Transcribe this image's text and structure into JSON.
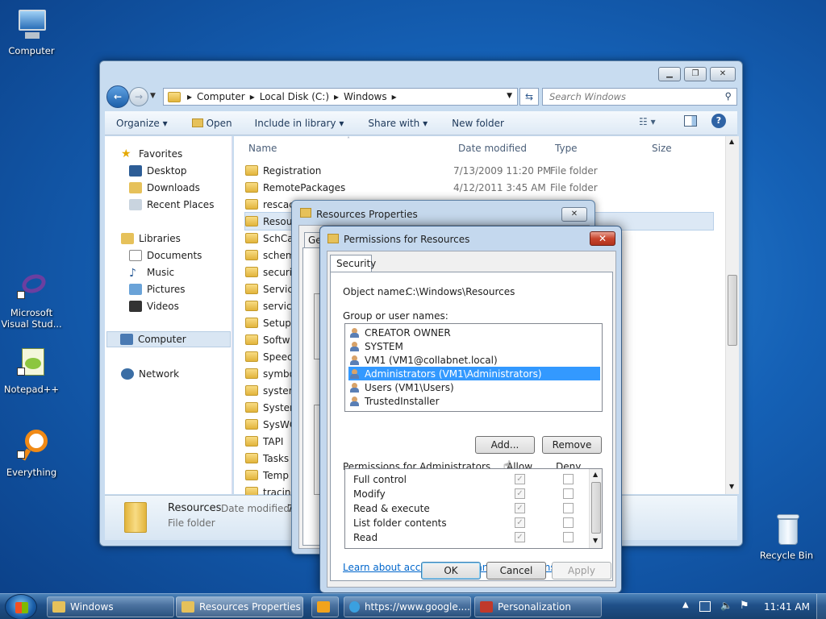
{
  "desktop": {
    "icons": [
      {
        "label": "Computer",
        "icon": "computer-icon"
      },
      {
        "label": "Microsoft Visual Stud...",
        "icon": "visual-studio-icon"
      },
      {
        "label": "Notepad++",
        "icon": "notepad-plus-icon"
      },
      {
        "label": "Everything",
        "icon": "everything-search-icon"
      },
      {
        "label": "Recycle Bin",
        "icon": "recycle-bin-icon"
      }
    ]
  },
  "explorer": {
    "breadcrumb": [
      "Computer",
      "Local Disk (C:)",
      "Windows"
    ],
    "search_placeholder": "Search Windows",
    "toolbar": {
      "organize": "Organize",
      "open": "Open",
      "include": "Include in library",
      "share": "Share with",
      "new_folder": "New folder"
    },
    "nav": {
      "favorites": "Favorites",
      "desktop": "Desktop",
      "downloads": "Downloads",
      "recent": "Recent Places",
      "libraries": "Libraries",
      "documents": "Documents",
      "music": "Music",
      "pictures": "Pictures",
      "videos": "Videos",
      "computer": "Computer",
      "network": "Network"
    },
    "columns": {
      "name": "Name",
      "date": "Date modified",
      "type": "Type",
      "size": "Size"
    },
    "files": [
      {
        "name": "Registration",
        "date": "7/13/2009 11:20 PM",
        "type": "File folder"
      },
      {
        "name": "RemotePackages",
        "date": "4/12/2011 3:45 AM",
        "type": "File folder"
      },
      {
        "name": "rescache",
        "date": "",
        "type": ""
      },
      {
        "name": "Resou",
        "date": "",
        "type": ""
      },
      {
        "name": "SchCa",
        "date": "",
        "type": ""
      },
      {
        "name": "schem",
        "date": "",
        "type": ""
      },
      {
        "name": "securi",
        "date": "",
        "type": ""
      },
      {
        "name": "Servic",
        "date": "",
        "type": ""
      },
      {
        "name": "servici",
        "date": "",
        "type": ""
      },
      {
        "name": "Setup",
        "date": "",
        "type": ""
      },
      {
        "name": "Softw",
        "date": "",
        "type": ""
      },
      {
        "name": "Speecl",
        "date": "",
        "type": ""
      },
      {
        "name": "symbo",
        "date": "",
        "type": ""
      },
      {
        "name": "system",
        "date": "",
        "type": ""
      },
      {
        "name": "Systen",
        "date": "",
        "type": ""
      },
      {
        "name": "SysWC",
        "date": "",
        "type": ""
      },
      {
        "name": "TAPI",
        "date": "",
        "type": ""
      },
      {
        "name": "Tasks",
        "date": "",
        "type": ""
      },
      {
        "name": "Temp",
        "date": "",
        "type": ""
      },
      {
        "name": "tracing",
        "date": "",
        "type": ""
      }
    ],
    "details": {
      "name": "Resources",
      "date_label": "Date modified:",
      "date_partial": "7",
      "type": "File folder"
    }
  },
  "properties_dialog": {
    "title": "Resources Properties",
    "tab_partial": "Ge"
  },
  "permissions_dialog": {
    "title": "Permissions for Resources",
    "tab": "Security",
    "object_label": "Object name:",
    "object_value": "C:\\Windows\\Resources",
    "groups_label": "Group or user names:",
    "users": [
      {
        "name": "CREATOR OWNER",
        "selected": false
      },
      {
        "name": "SYSTEM",
        "selected": false
      },
      {
        "name": "VM1 (VM1@collabnet.local)",
        "selected": false
      },
      {
        "name": "Administrators (VM1\\Administrators)",
        "selected": true
      },
      {
        "name": "Users (VM1\\Users)",
        "selected": false
      },
      {
        "name": "TrustedInstaller",
        "selected": false
      }
    ],
    "add_button": "Add...",
    "remove_button": "Remove",
    "perms_label": "Permissions for Administrators",
    "allow_label": "Allow",
    "deny_label": "Deny",
    "permissions": [
      {
        "name": "Full control",
        "allow": true,
        "deny": false
      },
      {
        "name": "Modify",
        "allow": true,
        "deny": false
      },
      {
        "name": "Read & execute",
        "allow": true,
        "deny": false
      },
      {
        "name": "List folder contents",
        "allow": true,
        "deny": false
      },
      {
        "name": "Read",
        "allow": true,
        "deny": false
      }
    ],
    "link": "Learn about access control and permissions",
    "ok": "OK",
    "cancel": "Cancel",
    "apply": "Apply"
  },
  "taskbar": {
    "items": [
      "Windows",
      "Resources Properties",
      "",
      "https://www.google....",
      "Personalization"
    ],
    "clock": "11:41 AM"
  }
}
